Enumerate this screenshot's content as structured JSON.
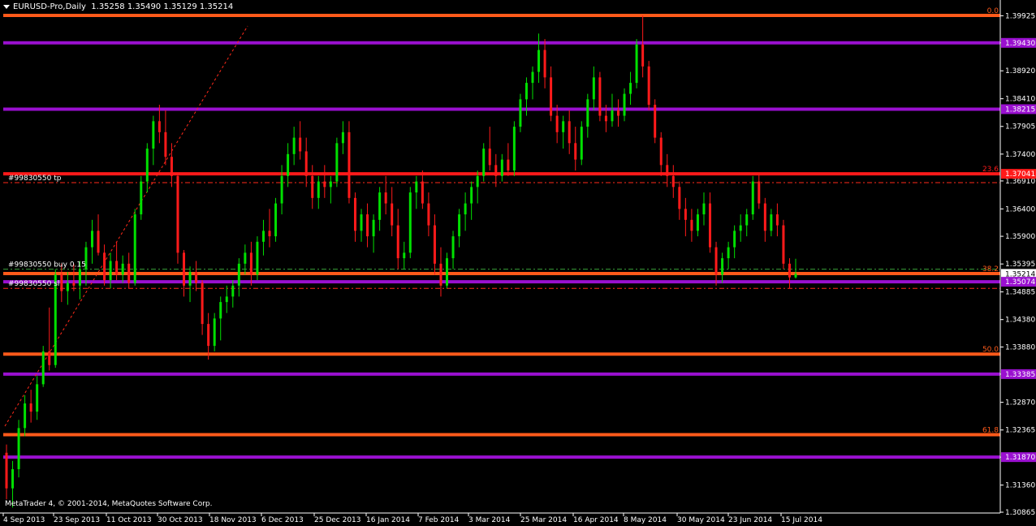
{
  "window": {
    "symbol_label": "EURUSD-Pro,Daily",
    "ohlc_label": "1.35258 1.35490 1.35129 1.35214",
    "copyright": "MetaTrader 4, © 2001-2014, MetaQuotes Software Corp."
  },
  "colors": {
    "background": "#000000",
    "bull": "#00e000",
    "bear": "#ff1a1a",
    "fib": "#ff5a1a",
    "sr": "#9a10d0",
    "grid_text": "#ffffff"
  },
  "chart_data": {
    "type": "candlestick",
    "title": "EURUSD-Pro,Daily",
    "ylim": [
      1.3085,
      1.3999
    ],
    "y_ticks": [
      "1.39925",
      "1.39430",
      "1.38920",
      "1.38410",
      "1.37905",
      "1.37400",
      "1.36910",
      "1.36400",
      "1.35900",
      "1.35395",
      "1.34885",
      "1.34380",
      "1.33880",
      "1.33385",
      "1.32870",
      "1.32365",
      "1.31870",
      "1.31360",
      "1.30865"
    ],
    "x_ticks": [
      "4 Sep 2013",
      "23 Sep 2013",
      "11 Oct 2013",
      "30 Oct 2013",
      "18 Nov 2013",
      "6 Dec 2013",
      "25 Dec 2013",
      "16 Jan 2014",
      "7 Feb 2014",
      "3 Mar 2014",
      "25 Mar 2014",
      "16 Apr 2014",
      "8 May 2014",
      "30 May 2014",
      "23 Jun 2014",
      "15 Jul 2014"
    ],
    "current_price": "1.35214",
    "price_labels": [
      {
        "text": "1.39430",
        "price": 1.3943,
        "color": "#9a10d0"
      },
      {
        "text": "1.38215",
        "price": 1.3822,
        "color": "#9a10d0"
      },
      {
        "text": "1.37041",
        "price": 1.3704,
        "color": "#ff1a1a"
      },
      {
        "text": "1.35214",
        "price": 1.35214,
        "color": "#ffffff"
      },
      {
        "text": "1.35074",
        "price": 1.3507,
        "color": "#9a10d0"
      },
      {
        "text": "1.33385",
        "price": 1.33385,
        "color": "#9a10d0"
      },
      {
        "text": "1.31870",
        "price": 1.3187,
        "color": "#9a10d0"
      }
    ],
    "fib_levels": [
      {
        "label": "0.0",
        "price": 1.3993
      },
      {
        "label": "23.6",
        "price": 1.3704
      },
      {
        "label": "38.2",
        "price": 1.3522
      },
      {
        "label": "50.0",
        "price": 1.3375
      },
      {
        "label": "61.8",
        "price": 1.3228
      }
    ],
    "sr_levels": [
      1.3943,
      1.3822,
      1.3507,
      1.33385,
      1.3187
    ],
    "orders": [
      {
        "label": "#99830550 tp",
        "price": 1.3688
      },
      {
        "label": "#99830550 buy 0.15",
        "price": 1.353
      },
      {
        "label": "#99830550 sl",
        "price": 1.3495
      }
    ],
    "candles": [
      [
        1.3195,
        1.321,
        1.311,
        1.313
      ],
      [
        1.313,
        1.318,
        1.3095,
        1.3165
      ],
      [
        1.3165,
        1.3255,
        1.315,
        1.324
      ],
      [
        1.324,
        1.33,
        1.3225,
        1.3285
      ],
      [
        1.3285,
        1.331,
        1.325,
        1.327
      ],
      [
        1.327,
        1.3335,
        1.3255,
        1.332
      ],
      [
        1.332,
        1.339,
        1.3315,
        1.338
      ],
      [
        1.338,
        1.346,
        1.3345,
        1.3355
      ],
      [
        1.3355,
        1.353,
        1.335,
        1.352
      ],
      [
        1.352,
        1.354,
        1.347,
        1.349
      ],
      [
        1.349,
        1.3525,
        1.3465,
        1.3505
      ],
      [
        1.3505,
        1.354,
        1.349,
        1.35
      ],
      [
        1.35,
        1.3545,
        1.3475,
        1.353
      ],
      [
        1.353,
        1.358,
        1.35,
        1.357
      ],
      [
        1.357,
        1.362,
        1.354,
        1.36
      ],
      [
        1.36,
        1.363,
        1.3555,
        1.356
      ],
      [
        1.356,
        1.3575,
        1.35,
        1.351
      ],
      [
        1.351,
        1.356,
        1.3495,
        1.3545
      ],
      [
        1.3545,
        1.358,
        1.351,
        1.352
      ],
      [
        1.352,
        1.3555,
        1.3505,
        1.354
      ],
      [
        1.354,
        1.356,
        1.3495,
        1.3505
      ],
      [
        1.3505,
        1.364,
        1.35,
        1.363
      ],
      [
        1.363,
        1.37,
        1.362,
        1.369
      ],
      [
        1.369,
        1.376,
        1.367,
        1.375
      ],
      [
        1.375,
        1.381,
        1.372,
        1.38
      ],
      [
        1.38,
        1.383,
        1.376,
        1.378
      ],
      [
        1.378,
        1.382,
        1.372,
        1.3735
      ],
      [
        1.3735,
        1.376,
        1.368,
        1.37
      ],
      [
        1.37,
        1.3705,
        1.354,
        1.356
      ],
      [
        1.356,
        1.3565,
        1.348,
        1.35
      ],
      [
        1.35,
        1.3535,
        1.347,
        1.3525
      ],
      [
        1.3525,
        1.3545,
        1.349,
        1.3505
      ],
      [
        1.3505,
        1.351,
        1.341,
        1.343
      ],
      [
        1.343,
        1.345,
        1.3365,
        1.339
      ],
      [
        1.339,
        1.345,
        1.338,
        1.344
      ],
      [
        1.344,
        1.348,
        1.34,
        1.347
      ],
      [
        1.347,
        1.35,
        1.345,
        1.348
      ],
      [
        1.348,
        1.351,
        1.346,
        1.35
      ],
      [
        1.35,
        1.355,
        1.348,
        1.354
      ],
      [
        1.354,
        1.3575,
        1.352,
        1.356
      ],
      [
        1.356,
        1.358,
        1.35,
        1.352
      ],
      [
        1.352,
        1.359,
        1.351,
        1.358
      ],
      [
        1.358,
        1.362,
        1.3555,
        1.36
      ],
      [
        1.36,
        1.364,
        1.357,
        1.359
      ],
      [
        1.359,
        1.366,
        1.358,
        1.365
      ],
      [
        1.365,
        1.372,
        1.363,
        1.37
      ],
      [
        1.37,
        1.376,
        1.368,
        1.374
      ],
      [
        1.374,
        1.379,
        1.372,
        1.377
      ],
      [
        1.377,
        1.38,
        1.373,
        1.3745
      ],
      [
        1.3745,
        1.377,
        1.368,
        1.37
      ],
      [
        1.37,
        1.372,
        1.364,
        1.366
      ],
      [
        1.366,
        1.37,
        1.364,
        1.369
      ],
      [
        1.369,
        1.372,
        1.366,
        1.368
      ],
      [
        1.368,
        1.37,
        1.365,
        1.369
      ],
      [
        1.369,
        1.377,
        1.368,
        1.376
      ],
      [
        1.376,
        1.38,
        1.374,
        1.378
      ],
      [
        1.378,
        1.38,
        1.365,
        1.366
      ],
      [
        1.366,
        1.367,
        1.358,
        1.36
      ],
      [
        1.36,
        1.364,
        1.358,
        1.363
      ],
      [
        1.363,
        1.365,
        1.357,
        1.359
      ],
      [
        1.359,
        1.363,
        1.356,
        1.362
      ],
      [
        1.362,
        1.368,
        1.36,
        1.367
      ],
      [
        1.367,
        1.37,
        1.363,
        1.365
      ],
      [
        1.365,
        1.368,
        1.359,
        1.361
      ],
      [
        1.361,
        1.364,
        1.353,
        1.355
      ],
      [
        1.355,
        1.358,
        1.353,
        1.356
      ],
      [
        1.356,
        1.368,
        1.355,
        1.367
      ],
      [
        1.367,
        1.37,
        1.364,
        1.369
      ],
      [
        1.369,
        1.371,
        1.364,
        1.365
      ],
      [
        1.365,
        1.367,
        1.359,
        1.361
      ],
      [
        1.361,
        1.363,
        1.352,
        1.354
      ],
      [
        1.354,
        1.357,
        1.348,
        1.35
      ],
      [
        1.35,
        1.356,
        1.3495,
        1.355
      ],
      [
        1.355,
        1.36,
        1.353,
        1.359
      ],
      [
        1.359,
        1.364,
        1.357,
        1.363
      ],
      [
        1.363,
        1.367,
        1.36,
        1.365
      ],
      [
        1.365,
        1.369,
        1.362,
        1.368
      ],
      [
        1.368,
        1.371,
        1.365,
        1.37
      ],
      [
        1.37,
        1.376,
        1.369,
        1.375
      ],
      [
        1.375,
        1.379,
        1.371,
        1.372
      ],
      [
        1.372,
        1.374,
        1.368,
        1.37
      ],
      [
        1.37,
        1.374,
        1.369,
        1.373
      ],
      [
        1.373,
        1.376,
        1.37,
        1.371
      ],
      [
        1.371,
        1.38,
        1.37,
        1.379
      ],
      [
        1.379,
        1.385,
        1.378,
        1.384
      ],
      [
        1.384,
        1.388,
        1.381,
        1.387
      ],
      [
        1.387,
        1.39,
        1.384,
        1.389
      ],
      [
        1.389,
        1.396,
        1.387,
        1.393
      ],
      [
        1.393,
        1.395,
        1.386,
        1.388
      ],
      [
        1.388,
        1.39,
        1.38,
        1.381
      ],
      [
        1.381,
        1.383,
        1.376,
        1.378
      ],
      [
        1.378,
        1.381,
        1.375,
        1.38
      ],
      [
        1.38,
        1.382,
        1.374,
        1.376
      ],
      [
        1.376,
        1.379,
        1.371,
        1.373
      ],
      [
        1.373,
        1.38,
        1.372,
        1.379
      ],
      [
        1.379,
        1.385,
        1.377,
        1.384
      ],
      [
        1.384,
        1.39,
        1.382,
        1.388
      ],
      [
        1.388,
        1.389,
        1.38,
        1.381
      ],
      [
        1.381,
        1.383,
        1.378,
        1.38
      ],
      [
        1.38,
        1.385,
        1.379,
        1.382
      ],
      [
        1.382,
        1.384,
        1.379,
        1.381
      ],
      [
        1.381,
        1.386,
        1.38,
        1.385
      ],
      [
        1.385,
        1.389,
        1.383,
        1.387
      ],
      [
        1.387,
        1.395,
        1.386,
        1.394
      ],
      [
        1.394,
        1.3993,
        1.388,
        1.39
      ],
      [
        1.39,
        1.391,
        1.382,
        1.383
      ],
      [
        1.383,
        1.384,
        1.376,
        1.377
      ],
      [
        1.377,
        1.378,
        1.37,
        1.372
      ],
      [
        1.372,
        1.374,
        1.368,
        1.37
      ],
      [
        1.37,
        1.372,
        1.366,
        1.368
      ],
      [
        1.368,
        1.369,
        1.362,
        1.364
      ],
      [
        1.364,
        1.366,
        1.359,
        1.362
      ],
      [
        1.362,
        1.364,
        1.358,
        1.36
      ],
      [
        1.36,
        1.364,
        1.359,
        1.363
      ],
      [
        1.363,
        1.367,
        1.361,
        1.365
      ],
      [
        1.365,
        1.367,
        1.356,
        1.357
      ],
      [
        1.357,
        1.358,
        1.35,
        1.352
      ],
      [
        1.352,
        1.356,
        1.3505,
        1.355
      ],
      [
        1.355,
        1.358,
        1.353,
        1.357
      ],
      [
        1.357,
        1.361,
        1.355,
        1.36
      ],
      [
        1.36,
        1.363,
        1.358,
        1.361
      ],
      [
        1.361,
        1.364,
        1.359,
        1.363
      ],
      [
        1.363,
        1.37,
        1.362,
        1.369
      ],
      [
        1.369,
        1.3705,
        1.364,
        1.365
      ],
      [
        1.365,
        1.366,
        1.358,
        1.36
      ],
      [
        1.36,
        1.364,
        1.359,
        1.363
      ],
      [
        1.363,
        1.365,
        1.359,
        1.361
      ],
      [
        1.361,
        1.362,
        1.353,
        1.354
      ],
      [
        1.354,
        1.355,
        1.3495,
        1.3515
      ],
      [
        1.3515,
        1.3549,
        1.3513,
        1.35214
      ]
    ]
  }
}
